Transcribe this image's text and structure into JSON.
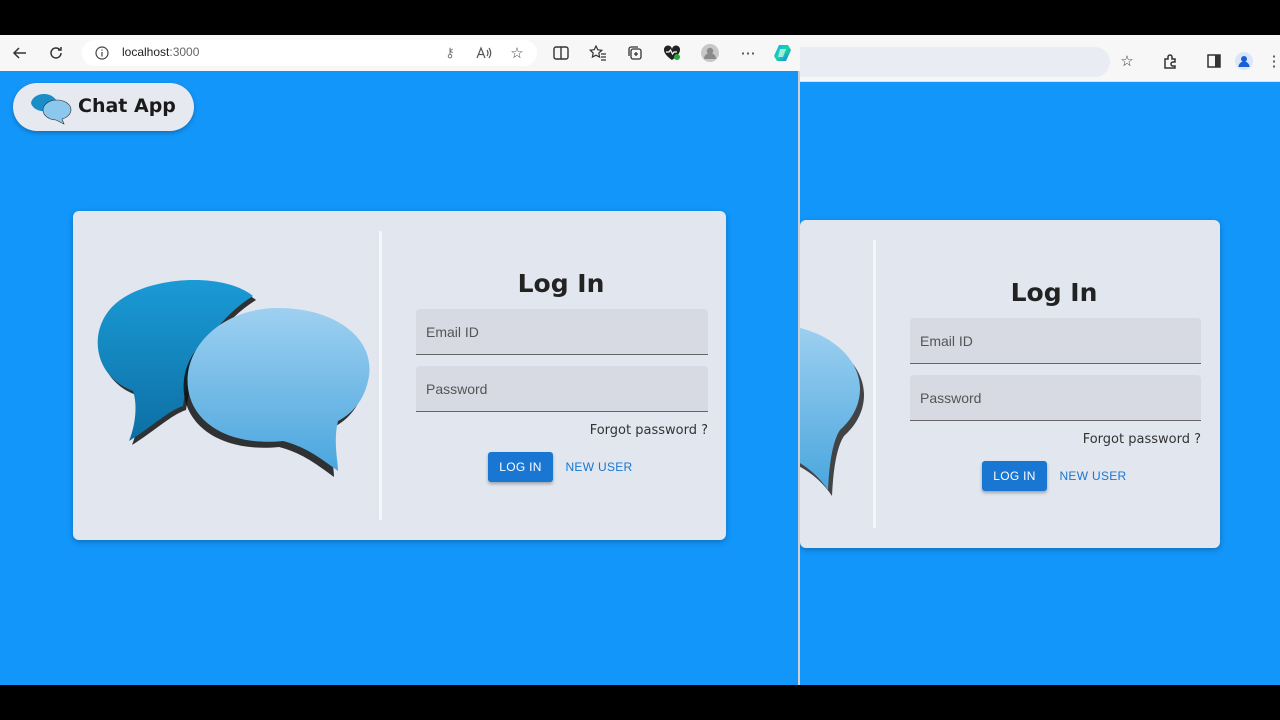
{
  "front_browser": {
    "url_host": "localhost",
    "url_port": ":3000"
  },
  "app": {
    "brand": "Chat App"
  },
  "login": {
    "title": "Log In",
    "email_placeholder": "Email ID",
    "password_placeholder": "Password",
    "forgot_label": "Forgot password ?",
    "login_label": "LOG IN",
    "new_user_label": "NEW USER"
  },
  "colors": {
    "page_background": "#1296F9",
    "card_background": "#e2e6ef",
    "primary_button": "#1976d2",
    "bubble_dark": "#1b8ec7",
    "bubble_light": "#7fc2ea"
  }
}
